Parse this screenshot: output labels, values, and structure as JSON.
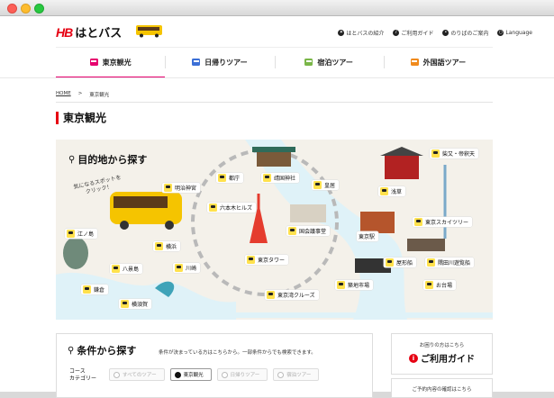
{
  "header": {
    "logo_mark": "HB",
    "logo_text": "はとバス",
    "util": [
      {
        "label": "はとバスの紹介",
        "icon": "dove-icon"
      },
      {
        "label": "ご利用ガイド",
        "icon": "info-icon"
      },
      {
        "label": "のりばのご案内",
        "icon": "pin-icon"
      },
      {
        "label": "Language",
        "icon": "globe-icon"
      }
    ]
  },
  "gnav": [
    {
      "label": "東京観光",
      "color": "#e6006e",
      "active": true
    },
    {
      "label": "日帰りツアー",
      "color": "#3b6fd6"
    },
    {
      "label": "宿泊ツアー",
      "color": "#7ab648"
    },
    {
      "label": "外国語ツアー",
      "color": "#f08a1c"
    }
  ],
  "breadcrumb": {
    "home": "HOME",
    "sep": ">",
    "current": "東京観光"
  },
  "page_title": "東京観光",
  "map": {
    "title": "目的地から探す",
    "bubble_line1": "気になるスポットを",
    "bubble_line2": "クリック！",
    "spots": {
      "s1": "都庁",
      "s2": "靖国神社",
      "s3": "柴又・帝釈天",
      "s4": "明治神宮",
      "s5": "皇居",
      "s6": "浅草",
      "s7": "六本木ヒルズ",
      "s8": "東京スカイツリー",
      "s9": "江ノ島",
      "s10": "国会議事堂",
      "s11": "東京駅",
      "s12": "横浜",
      "s13": "八景島",
      "s14": "川崎",
      "s15": "東京タワー",
      "s16": "屋形船",
      "s17": "隅田川遊覧船",
      "s18": "鎌倉",
      "s19": "築地市場",
      "s20": "お台場",
      "s21": "横須賀",
      "s22": "東京湾クルーズ"
    }
  },
  "search": {
    "title": "条件から探す",
    "sub": "条件が決まっている方はこちらから。一部条件からでも検索できます。",
    "course_label_1": "コース",
    "course_label_2": "カテゴリー",
    "options": [
      {
        "label": "すべてのツアー",
        "selected": false
      },
      {
        "label": "東京観光",
        "selected": true
      },
      {
        "label": "日帰りツアー",
        "selected": false
      },
      {
        "label": "宿泊ツアー",
        "selected": false
      }
    ]
  },
  "help": {
    "small": "お困りの方はこちら",
    "big": "ご利用ガイド",
    "second": "ご予約内容の確認はこちら"
  }
}
